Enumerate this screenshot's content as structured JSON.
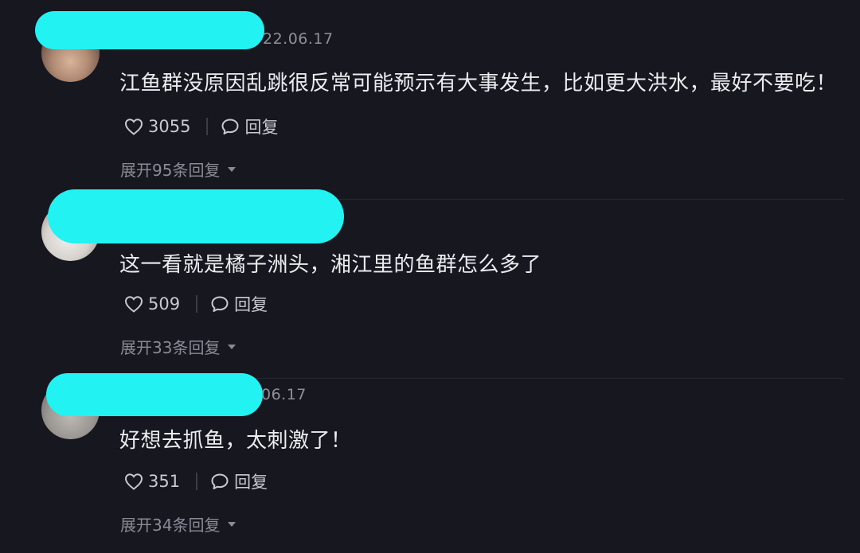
{
  "comments": [
    {
      "date": "22.06.17",
      "text": "江鱼群没原因乱跳很反常可能预示有大事发生，比如更大洪水，最好不要吃！",
      "likes": "3055",
      "reply_label": "回复",
      "expand_label": "展开95条回复"
    },
    {
      "date": "",
      "text": "这一看就是橘子洲头，湘江里的鱼群怎么多了",
      "likes": "509",
      "reply_label": "回复",
      "expand_label": "展开33条回复"
    },
    {
      "date": "06.17",
      "text": "好想去抓鱼，太刺激了！",
      "likes": "351",
      "reply_label": "回复",
      "expand_label": "展开34条回复"
    }
  ],
  "icons": {
    "like": "heart-outline-icon",
    "reply": "speech-bubble-icon",
    "expand": "caret-down-icon"
  },
  "colors": {
    "background": "#16171f",
    "redaction": "#23f2f2",
    "text": "#ecebf0",
    "muted": "#8a8b94"
  }
}
